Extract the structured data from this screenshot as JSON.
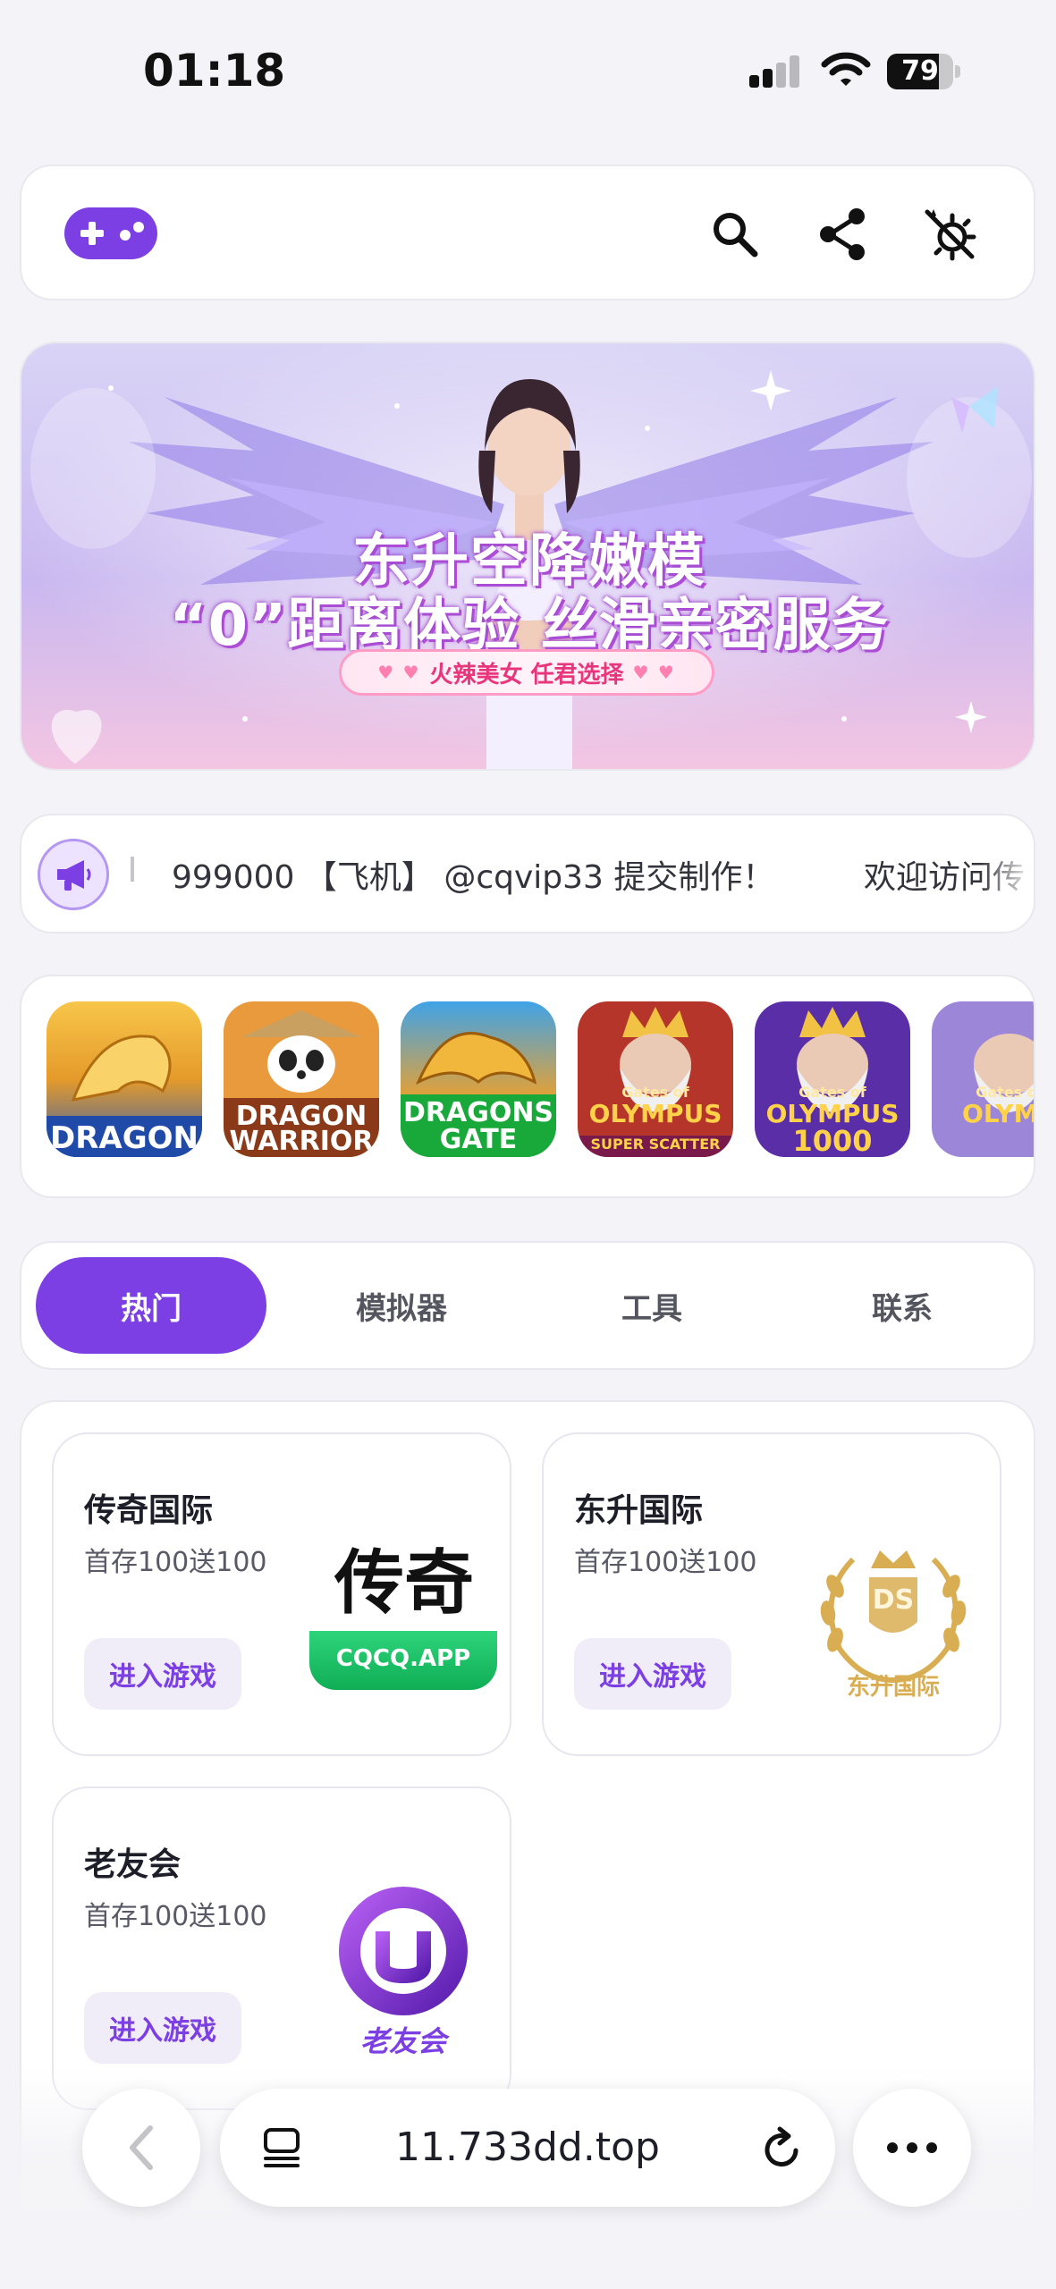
{
  "status_bar": {
    "time": "01:18",
    "battery": "79",
    "battery_level": 0.79
  },
  "header": {
    "logo_icon": "gamepad-icon",
    "icons": [
      "search-icon",
      "share-icon",
      "theme-toggle-icon"
    ]
  },
  "banner": {
    "headline_1": "东升空降嫩模",
    "headline_2": "“0”距离体验 丝滑亲密服务",
    "pill_text": "火辣美女 任君选择"
  },
  "announcement": {
    "icon": "megaphone-icon",
    "text": "999000 【飞机】 @cqvip33 提交制作！",
    "text_next": "欢迎访问传"
  },
  "game_strip": [
    {
      "label": "DRAGON",
      "colors": [
        "#f2b233",
        "#2f5fb8"
      ]
    },
    {
      "label_1": "DRAGON",
      "label_2": "WARRIOR",
      "colors": [
        "#e89a3c",
        "#7a3215"
      ]
    },
    {
      "label_1": "DRAGONS",
      "label_2": "GATE",
      "colors": [
        "#2d8fd8",
        "#1aa83b"
      ]
    },
    {
      "label_1": "Gates of",
      "label_2": "OLYMPUS",
      "label_3": "SUPER SCATTER",
      "colors": [
        "#c13a2a",
        "#6a1f5a"
      ]
    },
    {
      "label_1": "Gates of",
      "label_2": "OLYMPUS",
      "label_3": "1000",
      "colors": [
        "#8a4fd0",
        "#3b2580"
      ]
    },
    {
      "label_1": "Gates of",
      "label_2": "OLYMP",
      "colors": [
        "#a58ad8",
        "#5b3aa0"
      ]
    }
  ],
  "tabs": [
    {
      "label": "热门",
      "active": true
    },
    {
      "label": "模拟器",
      "active": false
    },
    {
      "label": "工具",
      "active": false
    },
    {
      "label": "联系",
      "active": false
    }
  ],
  "games": [
    {
      "name": "传奇国际",
      "promo": "首存100送100",
      "button": "进入游戏",
      "logo_text": "传奇",
      "logo_sub": "CQCQ.APP"
    },
    {
      "name": "东升国际",
      "promo": "首存100送100",
      "button": "进入游戏",
      "logo_text": "DS",
      "logo_sub": "东升国际"
    },
    {
      "name": "老友会",
      "promo": "首存100送100",
      "button": "进入游戏",
      "logo_text": "老友会"
    }
  ],
  "browser": {
    "url": "11.733dd.top"
  },
  "colors": {
    "accent": "#7b3fe4",
    "page_bg": "#f4f4f8"
  }
}
